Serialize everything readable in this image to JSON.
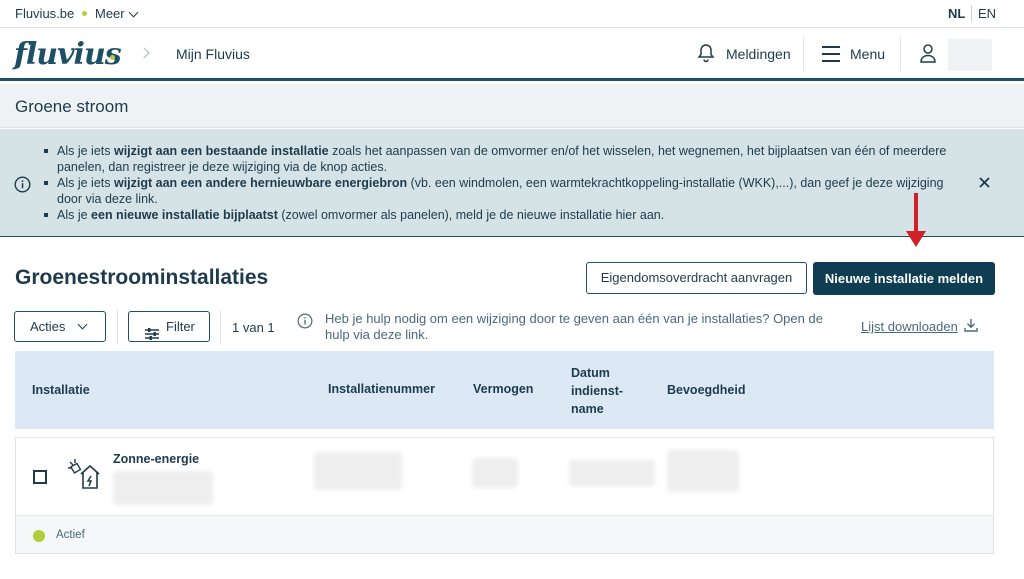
{
  "topbar": {
    "site": "Fluvius.be",
    "more": "Meer",
    "lang_nl": "NL",
    "lang_en": "EN"
  },
  "header": {
    "logo": "fluvius",
    "breadcrumb": "Mijn Fluvius",
    "notifications": "Meldingen",
    "menu": "Menu"
  },
  "page": {
    "title": "Groene stroom"
  },
  "info": {
    "items": [
      {
        "pre": "Als je iets ",
        "bold": "wijzigt aan een bestaande installatie",
        "post": " zoals het aanpassen van de omvormer en/of het wisselen, het wegnemen, het bijplaatsen van één of meerdere panelen, dan registreer je deze wijziging via de knop acties."
      },
      {
        "pre": "Als je iets ",
        "bold": "wijzigt aan een andere hernieuwbare energiebron",
        "post": " (vb. een windmolen, een warmtekrachtkoppeling-installatie (WKK),...), dan geef je deze wijziging door via deze ",
        "link": "link",
        "end": "."
      },
      {
        "pre": "Als je ",
        "bold": "een nieuwe installatie bijplaatst",
        "post": " (zowel omvormer als panelen), meld je de nieuwe installatie ",
        "link": "hier",
        "end": " aan."
      }
    ]
  },
  "section": {
    "title": "Groenestroominstallaties",
    "btn_transfer": "Eigendomsoverdracht aanvragen",
    "btn_new": "Nieuwe installatie melden",
    "btn_actions": "Acties",
    "btn_filter": "Filter",
    "pager": "1 van 1",
    "help_pre": "Heb je hulp nodig om een wijziging door te geven aan één van je installaties? Open de hulp via ",
    "help_link": "deze link",
    "help_end": ".",
    "download": "Lijst downloaden"
  },
  "table": {
    "headers": [
      "Installatie",
      "Installatienummer",
      "Vermogen",
      "Datum indienst-name",
      "Bevoegdheid"
    ],
    "rows": [
      {
        "type": "Zonne-energie",
        "status": "Actief"
      }
    ]
  },
  "colors": {
    "primary": "#0f3d52",
    "accent_green": "#b3cc3a",
    "info_bg": "#d5e3e7",
    "arrow_red": "#d0202a"
  }
}
